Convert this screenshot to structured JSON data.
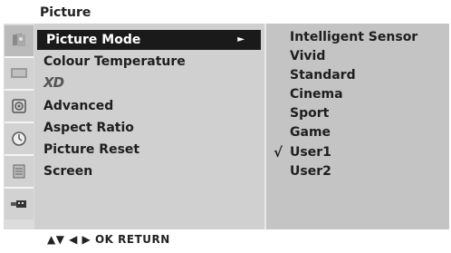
{
  "header": {
    "title": "Picture"
  },
  "sidebar": {
    "icons": [
      {
        "name": "picture-icon"
      },
      {
        "name": "screen-icon"
      },
      {
        "name": "audio-icon"
      },
      {
        "name": "timer-icon"
      },
      {
        "name": "option-icon"
      },
      {
        "name": "input-icon"
      }
    ]
  },
  "menu": {
    "items": [
      {
        "label": "Picture Mode",
        "selected": true
      },
      {
        "label": "Colour Temperature"
      },
      {
        "label": "XD"
      },
      {
        "label": "Advanced"
      },
      {
        "label": "Aspect Ratio"
      },
      {
        "label": "Picture Reset"
      },
      {
        "label": "Screen"
      }
    ],
    "arrow": "►"
  },
  "submenu": {
    "checkmark": "√",
    "items": [
      {
        "label": "Intelligent Sensor"
      },
      {
        "label": "Vivid"
      },
      {
        "label": "Standard"
      },
      {
        "label": "Cinema"
      },
      {
        "label": "Sport"
      },
      {
        "label": "Game"
      },
      {
        "label": "User1",
        "checked": true
      },
      {
        "label": "User2"
      }
    ]
  },
  "footer": {
    "hint": "▲▼  ◀ ▶  OK  RETURN"
  },
  "colors": {
    "highlight_bg": "#1a1a1a",
    "panel_bg": "#cccccc"
  }
}
